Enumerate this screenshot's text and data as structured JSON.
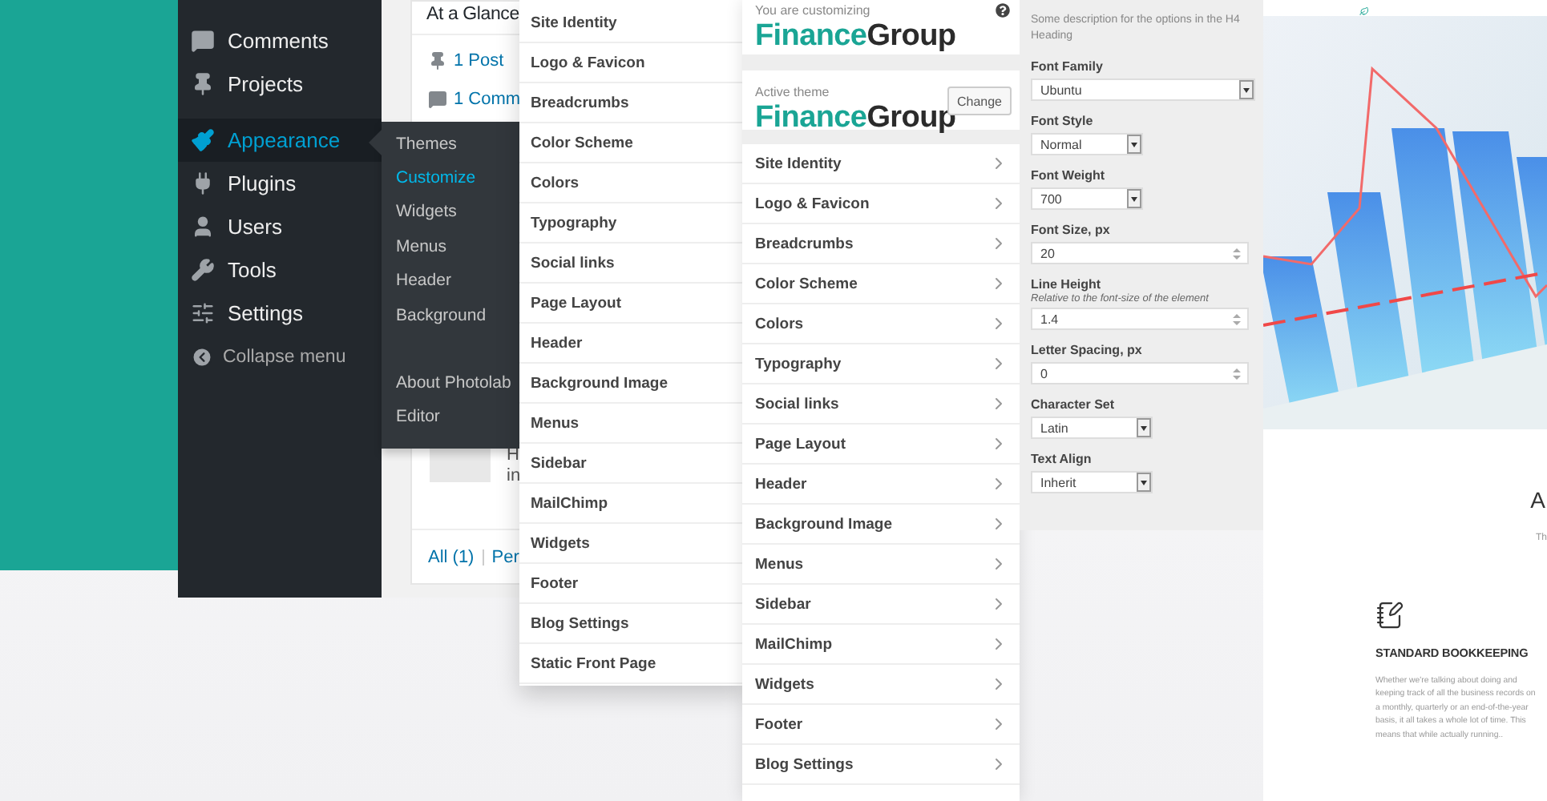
{
  "admin_menu": {
    "items": [
      {
        "label": "Comments",
        "selected": false
      },
      {
        "label": "Projects",
        "selected": false
      },
      {
        "label": "Appearance",
        "selected": true
      },
      {
        "label": "Plugins",
        "selected": false
      },
      {
        "label": "Users",
        "selected": false
      },
      {
        "label": "Tools",
        "selected": false
      },
      {
        "label": "Settings",
        "selected": false
      }
    ],
    "collapse": "Collapse menu",
    "submenu": [
      [
        {
          "label": "Themes",
          "selected": false
        },
        {
          "label": "Customize",
          "selected": true
        },
        {
          "label": "Widgets",
          "selected": false
        },
        {
          "label": "Menus",
          "selected": false
        },
        {
          "label": "Header",
          "selected": false
        },
        {
          "label": "Background",
          "selected": false
        }
      ],
      [
        {
          "label": "About Photolab",
          "selected": false
        },
        {
          "label": "Editor",
          "selected": false
        }
      ]
    ]
  },
  "dashboard": {
    "title": "At a Glance",
    "stats": [
      {
        "label": "1 Post"
      },
      {
        "label": "1 Comm"
      }
    ],
    "comment_lines": [
      "H",
      "in"
    ],
    "filters": [
      "All (1)",
      "Per"
    ]
  },
  "sections_panel": {
    "items": [
      "Site Identity",
      "Logo & Favicon",
      "Breadcrumbs",
      "Color Scheme",
      "Colors",
      "Typography",
      "Social links",
      "Page Layout",
      "Header",
      "Background Image",
      "Menus",
      "Sidebar",
      "MailChimp",
      "Widgets",
      "Footer",
      "Blog Settings",
      "Static Front Page"
    ]
  },
  "customizer": {
    "intro": "You are customizing",
    "logo": {
      "first": "Finance",
      "second": "Group"
    },
    "active_label": "Active theme",
    "active_logo": {
      "first": "Finance",
      "second": "Group"
    },
    "change_button": "Change",
    "sections": [
      "Site Identity",
      "Logo & Favicon",
      "Breadcrumbs",
      "Color Scheme",
      "Colors",
      "Typography",
      "Social links",
      "Page Layout",
      "Header",
      "Background Image",
      "Menus",
      "Sidebar",
      "MailChimp",
      "Widgets",
      "Footer",
      "Blog Settings"
    ]
  },
  "typography": {
    "description": "Some description for the options in the H4 Heading",
    "fields": [
      {
        "label": "Font Family",
        "kind": "select",
        "wide": true,
        "value": "Ubuntu"
      },
      {
        "label": "Font Style",
        "kind": "select",
        "wide": false,
        "value": "Normal"
      },
      {
        "label": "Font Weight",
        "kind": "select",
        "wide": false,
        "value": "700"
      },
      {
        "label": "Font Size, px",
        "kind": "number",
        "value": "20"
      },
      {
        "label": "Line Height",
        "note": "Relative to the font-size of the element",
        "kind": "number",
        "value": "1.4"
      },
      {
        "label": "Letter Spacing, px",
        "kind": "number",
        "value": "0"
      },
      {
        "label": "Character Set",
        "kind": "select",
        "wide": false,
        "value": "Latin"
      },
      {
        "label": "Text Align",
        "kind": "select",
        "wide": false,
        "value": "Inherit"
      }
    ]
  },
  "website": {
    "heading": "A",
    "subtext": "Th",
    "service": {
      "title": "STANDARD BOOKKEEPING",
      "text": "Whether we're talking about doing and keeping track of all the business records on a monthly, quarterly or an end-of-the-year basis, it all takes a whole lot of time. This means that while actually running.."
    }
  }
}
